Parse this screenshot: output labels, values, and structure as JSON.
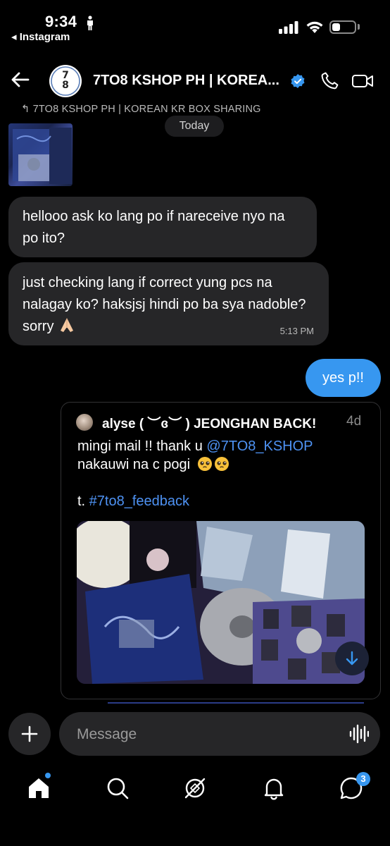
{
  "status_bar": {
    "time": "9:34",
    "back_app": "◂ Instagram"
  },
  "header": {
    "avatar_text_top": "7",
    "avatar_text_mid": "8",
    "title": "7TO8 KSHOP PH | KOREA...",
    "verified": true,
    "call_icon": "phone-icon",
    "video_icon": "video-camera-icon"
  },
  "chat": {
    "reply_note": "↰ 7TO8 KSHOP PH | KOREAN KR BOX SHARING",
    "date_divider": "Today",
    "messages": [
      {
        "text": "hellooo ask ko lang po if nareceive nyo na po ito?"
      },
      {
        "text": "just checking lang if correct yung pcs na nalagay ko? haksjsj hindi po ba sya nadoble? sorry",
        "emoji": "folded-hands",
        "time": "5:13 PM"
      }
    ],
    "sent_reply": "yes p!!",
    "shared_post": {
      "user": "alyse ( ︶ɞ︶ ) JEONGHAN BACK!",
      "age": "4d",
      "line1_prefix": "mingi mail !! thank u ",
      "mention": "@7TO8_KSHOP",
      "line2": "nakauwi na c pogi",
      "emojis": "pleading-face x2",
      "tag_prefix": "t. ",
      "hashtag": "#7to8_feedback"
    }
  },
  "composer": {
    "placeholder": "Message"
  },
  "nav": {
    "items": [
      "home",
      "search",
      "explore",
      "notifications",
      "messages"
    ],
    "messages_badge": "3"
  },
  "colors": {
    "accent": "#3797f0",
    "bubble": "#262628",
    "link": "#4e92f3",
    "background": "#000000"
  }
}
